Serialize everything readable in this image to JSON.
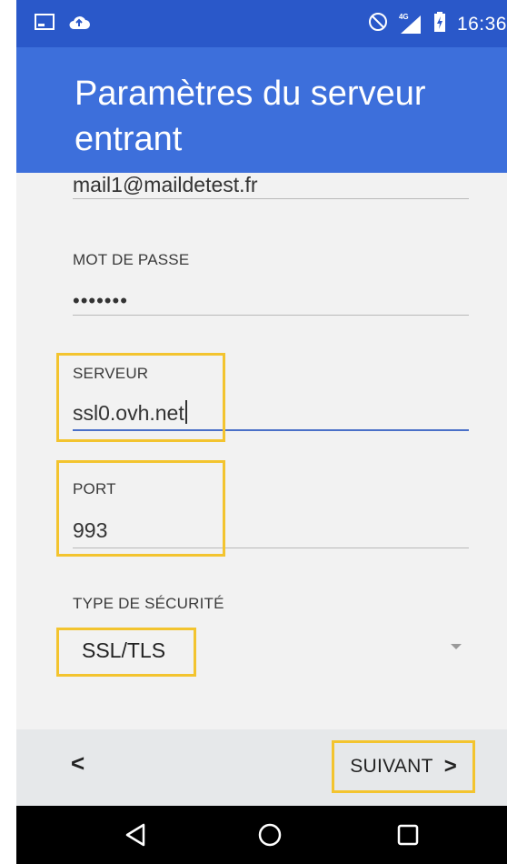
{
  "status_bar": {
    "time": "16:36",
    "network": "4G"
  },
  "header": {
    "title": "Paramètres du serveur entrant"
  },
  "form": {
    "username_value": "mail1@maildetest.fr",
    "password_label": "MOT DE PASSE",
    "password_value": "•••••••",
    "server_label": "SERVEUR",
    "server_value": "ssl0.ovh.net",
    "port_label": "PORT",
    "port_value": "993",
    "security_label": "TYPE DE SÉCURITÉ",
    "security_value": "SSL/TLS"
  },
  "actions": {
    "back_glyph": "<",
    "next_label": "SUIVANT",
    "next_glyph": ">"
  },
  "colors": {
    "status_bar": "#2a58c9",
    "header": "#3d6fdb",
    "highlight": "#f3c42f",
    "focus_underline": "#4a70c8"
  },
  "icons": [
    "screenshot-icon",
    "cloud-upload-icon",
    "do-not-disturb-icon",
    "signal-4g-icon",
    "battery-charging-icon",
    "nav-back-icon",
    "nav-home-icon",
    "nav-recents-icon",
    "dropdown-arrow-icon"
  ]
}
